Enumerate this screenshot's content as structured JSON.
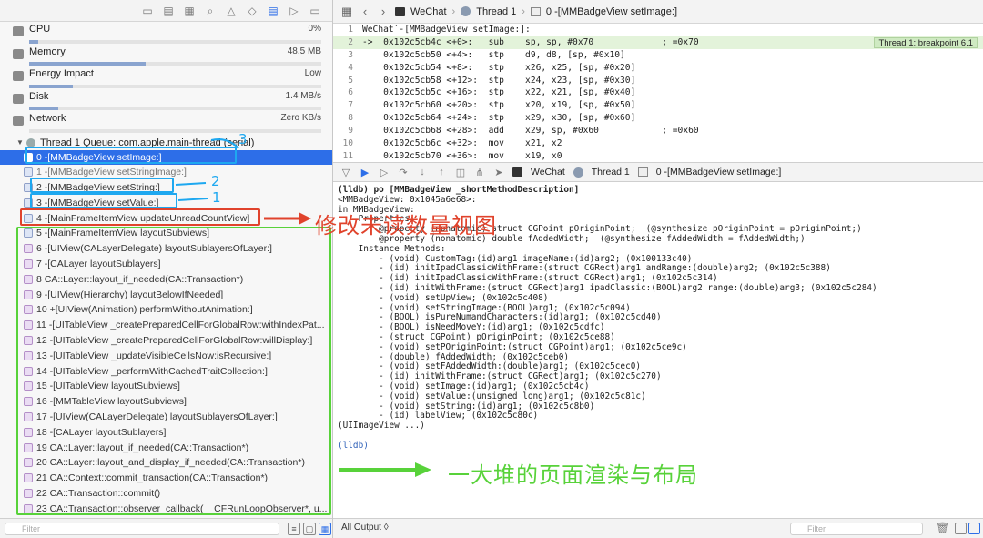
{
  "gauges": [
    {
      "label": "CPU",
      "value": "0%",
      "fill_pct": 3
    },
    {
      "label": "Memory",
      "value": "48.5 MB",
      "fill_pct": 40
    },
    {
      "label": "Energy Impact",
      "value": "Low",
      "fill_pct": 15
    },
    {
      "label": "Disk",
      "value": "1.4 MB/s",
      "fill_pct": 10
    },
    {
      "label": "Network",
      "value": "Zero KB/s",
      "fill_pct": 0
    }
  ],
  "thread": {
    "label": "Thread 1 Queue: com.apple.main-thread (serial)"
  },
  "frames": [
    "0 -[MMBadgeView setImage:]",
    "1 -[MMBadgeView setStringImage:]",
    "2 -[MMBadgeView setString:]",
    "3 -[MMBadgeView setValue:]",
    "4 -[MainFrameItemView updateUnreadCountView]",
    "5 -[MainFrameItemView layoutSubviews]",
    "6 -[UIView(CALayerDelegate) layoutSublayersOfLayer:]",
    "7 -[CALayer layoutSublayers]",
    "8 CA::Layer::layout_if_needed(CA::Transaction*)",
    "9 -[UIView(Hierarchy) layoutBelowIfNeeded]",
    "10 +[UIView(Animation) performWithoutAnimation:]",
    "11 -[UITableView _createPreparedCellForGlobalRow:withIndexPat...",
    "12 -[UITableView _createPreparedCellForGlobalRow:willDisplay:]",
    "13 -[UITableView _updateVisibleCellsNow:isRecursive:]",
    "14 -[UITableView _performWithCachedTraitCollection:]",
    "15 -[UITableView layoutSubviews]",
    "16 -[MMTableView layoutSubviews]",
    "17 -[UIView(CALayerDelegate) layoutSublayersOfLayer:]",
    "18 -[CALayer layoutSublayers]",
    "19 CA::Layer::layout_if_needed(CA::Transaction*)",
    "20 CA::Layer::layout_and_display_if_needed(CA::Transaction*)",
    "21 CA::Context::commit_transaction(CA::Transaction*)",
    "22 CA::Transaction::commit()",
    "23 CA::Transaction::observer_callback(__CFRunLoopObserver*, u..."
  ],
  "left_filter_placeholder": "Filter",
  "jumpbar": {
    "app": "WeChat",
    "thread": "Thread 1",
    "frame": "0 -[MMBadgeView setImage:]"
  },
  "code": {
    "lines": [
      {
        "n": "1",
        "text": "WeChat`-[MMBadgeView setImage:]:"
      },
      {
        "n": "2",
        "text": "->  0x102c5cb4c <+0>:   sub    sp, sp, #0x70             ; =0x70"
      },
      {
        "n": "3",
        "text": "    0x102c5cb50 <+4>:   stp    d9, d8, [sp, #0x10]"
      },
      {
        "n": "4",
        "text": "    0x102c5cb54 <+8>:   stp    x26, x25, [sp, #0x20]"
      },
      {
        "n": "5",
        "text": "    0x102c5cb58 <+12>:  stp    x24, x23, [sp, #0x30]"
      },
      {
        "n": "6",
        "text": "    0x102c5cb5c <+16>:  stp    x22, x21, [sp, #0x40]"
      },
      {
        "n": "7",
        "text": "    0x102c5cb60 <+20>:  stp    x20, x19, [sp, #0x50]"
      },
      {
        "n": "8",
        "text": "    0x102c5cb64 <+24>:  stp    x29, x30, [sp, #0x60]"
      },
      {
        "n": "9",
        "text": "    0x102c5cb68 <+28>:  add    x29, sp, #0x60            ; =0x60"
      },
      {
        "n": "10",
        "text": "    0x102c5cb6c <+32>:  mov    x21, x2"
      },
      {
        "n": "11",
        "text": "    0x102c5cb70 <+36>:  mov    x19, x0"
      }
    ],
    "breakpoint_label": "Thread 1: breakpoint 6.1"
  },
  "console": {
    "lines": [
      "(lldb) po [MMBadgeView _shortMethodDescription]",
      "<MMBadgeView: 0x1045a6e68>:",
      "in MMBadgeView:",
      "    Properties:",
      "        @property (nonatomic) struct CGPoint pOriginPoint;  (@synthesize pOriginPoint = pOriginPoint;)",
      "        @property (nonatomic) double fAddedWidth;  (@synthesize fAddedWidth = fAddedWidth;)",
      "    Instance Methods:",
      "        - (void) CustomTag:(id)arg1 imageName:(id)arg2; (0x100133c40)",
      "        - (id) initIpadClassicWithFrame:(struct CGRect)arg1 andRange:(double)arg2; (0x102c5c388)",
      "        - (id) initIpadClassicWithFrame:(struct CGRect)arg1; (0x102c5c314)",
      "        - (id) initWithFrame:(struct CGRect)arg1 ipadClassic:(BOOL)arg2 range:(double)arg3; (0x102c5c284)",
      "        - (void) setUpView; (0x102c5c408)",
      "        - (void) setStringImage:(BOOL)arg1; (0x102c5c094)",
      "        - (BOOL) isPureNumandCharacters:(id)arg1; (0x102c5cd40)",
      "        - (BOOL) isNeedMoveY:(id)arg1; (0x102c5cdfc)",
      "        - (struct CGPoint) pOriginPoint; (0x102c5ce88)",
      "        - (void) setPOriginPoint:(struct CGPoint)arg1; (0x102c5ce9c)",
      "        - (double) fAddedWidth; (0x102c5ceb0)",
      "        - (void) setFAddedWidth:(double)arg1; (0x102c5cec0)",
      "        - (id) initWithFrame:(struct CGRect)arg1; (0x102c5c270)",
      "        - (void) setImage:(id)arg1; (0x102c5cb4c)",
      "        - (void) setValue:(unsigned long)arg1; (0x102c5c81c)",
      "        - (void) setString:(id)arg1; (0x102c5c8b0)",
      "        - (id) labelView; (0x102c5c80c)",
      "(UIImageView ...)",
      "",
      "(lldb)"
    ]
  },
  "output_selector": "All Output ◊",
  "right_filter_placeholder": "Filter",
  "annotations": {
    "n3": "3",
    "n2": "2",
    "n1": "1",
    "red_text": "修改未读数量视图",
    "green_text": "一大堆的页面渲染与布局"
  }
}
